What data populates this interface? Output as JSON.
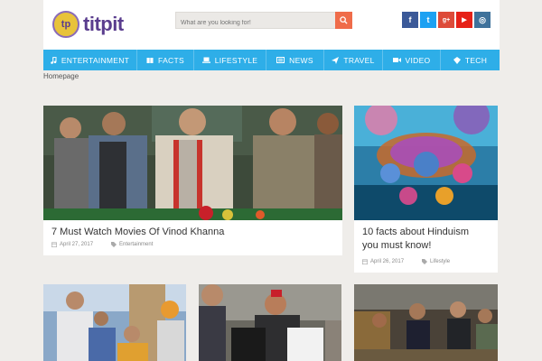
{
  "brand": {
    "logo_mark": "tp",
    "name": "titpit"
  },
  "search": {
    "placeholder": "What are you looking for!"
  },
  "social": [
    {
      "label": "f",
      "name": "facebook-icon",
      "color": "#3b5998"
    },
    {
      "label": "t",
      "name": "twitter-icon",
      "color": "#1da1f2"
    },
    {
      "label": "g+",
      "name": "googleplus-icon",
      "color": "#dd4b39"
    },
    {
      "label": "▶",
      "name": "youtube-icon",
      "color": "#e62117"
    },
    {
      "label": "◎",
      "name": "instagram-icon",
      "color": "#3f729b"
    }
  ],
  "nav": [
    {
      "label": "ENTERTAINMENT",
      "icon": "music-icon"
    },
    {
      "label": "FACTS",
      "icon": "book-icon"
    },
    {
      "label": "LIFESTYLE",
      "icon": "laptop-icon"
    },
    {
      "label": "NEWS",
      "icon": "newspaper-icon"
    },
    {
      "label": "TRAVEL",
      "icon": "plane-icon"
    },
    {
      "label": "VIDEO",
      "icon": "video-icon"
    },
    {
      "label": "TECH",
      "icon": "tech-icon"
    }
  ],
  "breadcrumb": "Homepage",
  "articles": [
    {
      "title": "7 Must Watch Movies Of Vinod Khanna",
      "date": "April 27, 2017",
      "category": "Entertainment"
    },
    {
      "title_line1": "10 facts about Hinduism",
      "title_line2": "you must know!",
      "date": "April 26, 2017",
      "category": "Lifestyle"
    }
  ],
  "colors": {
    "accent": "#2eaee8",
    "search_button": "#ef6c4a",
    "background": "#efedea"
  }
}
